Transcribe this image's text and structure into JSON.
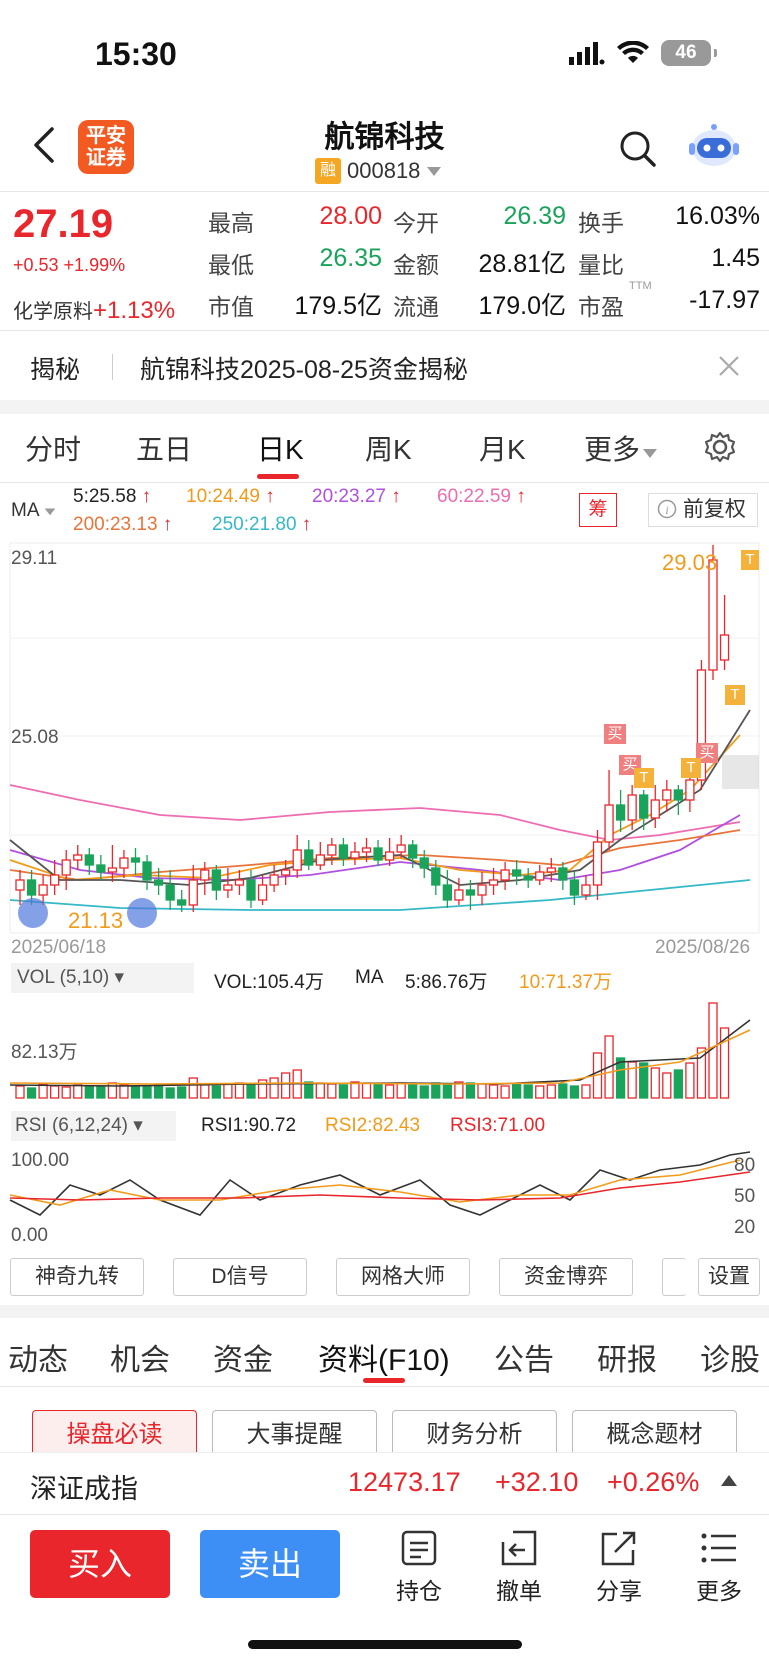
{
  "status_bar": {
    "time": "15:30",
    "network": "46"
  },
  "header": {
    "logo_text": "平安证券",
    "stock_name": "航锦科技",
    "margin_badge": "融",
    "stock_code": "000818"
  },
  "quote": {
    "price": "27.19",
    "change": "+0.53 +1.99%",
    "sector_name": "化学原料",
    "sector_change": "+1.13%",
    "fields": [
      {
        "label": "最高",
        "value": "28.00",
        "color": "red"
      },
      {
        "label": "今开",
        "value": "26.39",
        "color": "green"
      },
      {
        "label": "换手",
        "value": "16.03%",
        "color": "black"
      },
      {
        "label": "最低",
        "value": "26.35",
        "color": "green"
      },
      {
        "label": "金额",
        "value": "28.81亿",
        "color": "black"
      },
      {
        "label": "量比",
        "value": "1.45",
        "color": "black"
      },
      {
        "label": "市值",
        "value": "179.5亿",
        "color": "black"
      },
      {
        "label": "流通",
        "value": "179.0亿",
        "color": "black"
      },
      {
        "label": "市盈",
        "value": "-17.97",
        "color": "black",
        "suffix": "TTM"
      }
    ]
  },
  "reveal": {
    "label": "揭秘",
    "text": "航锦科技2025-08-25资金揭秘"
  },
  "period_tabs": [
    "分时",
    "五日",
    "日K",
    "周K",
    "月K",
    "更多"
  ],
  "kline": {
    "ma_label": "MA",
    "ma_values": [
      "5:25.58",
      "10:24.49",
      "20:23.27",
      "60:22.59",
      "200:23.13",
      "250:21.80"
    ],
    "chip_label": "筹",
    "adjust_label": "前复权",
    "y_top": "29.11",
    "y_mid": "25.08",
    "high_label": "29.03",
    "low_label": "21.13",
    "date_start": "2025/06/18",
    "date_end": "2025/08/26",
    "buy_mark": "买",
    "t_mark": "T"
  },
  "volume": {
    "indicator": "VOL (5,10)",
    "vol": "VOL:105.4万",
    "ma_label": "MA",
    "ma5": "5:86.76万",
    "ma10": "10:71.37万",
    "axis": "82.13万"
  },
  "rsi": {
    "indicator": "RSI (6,12,24)",
    "rsi1": "RSI1:90.72",
    "rsi2": "RSI2:82.43",
    "rsi3": "RSI3:71.00",
    "y_top": "100.00",
    "y_bottom": "0.00",
    "ticks": [
      "80",
      "50",
      "20"
    ]
  },
  "tools": [
    "神奇九转",
    "D信号",
    "网格大师",
    "资金博弈",
    "设置"
  ],
  "info_tabs": [
    "动态",
    "机会",
    "资金",
    "资料(F10)",
    "公告",
    "研报",
    "诊股"
  ],
  "info_sub_buttons": [
    "操盘必读",
    "大事提醒",
    "财务分析",
    "概念题材"
  ],
  "index_bar": {
    "name": "深证成指",
    "value": "12473.17",
    "change": "+32.10",
    "pct": "+0.26%"
  },
  "trade_bar": {
    "buy": "买入",
    "sell": "卖出",
    "actions": [
      "持仓",
      "撤单",
      "分享",
      "更多"
    ]
  }
}
